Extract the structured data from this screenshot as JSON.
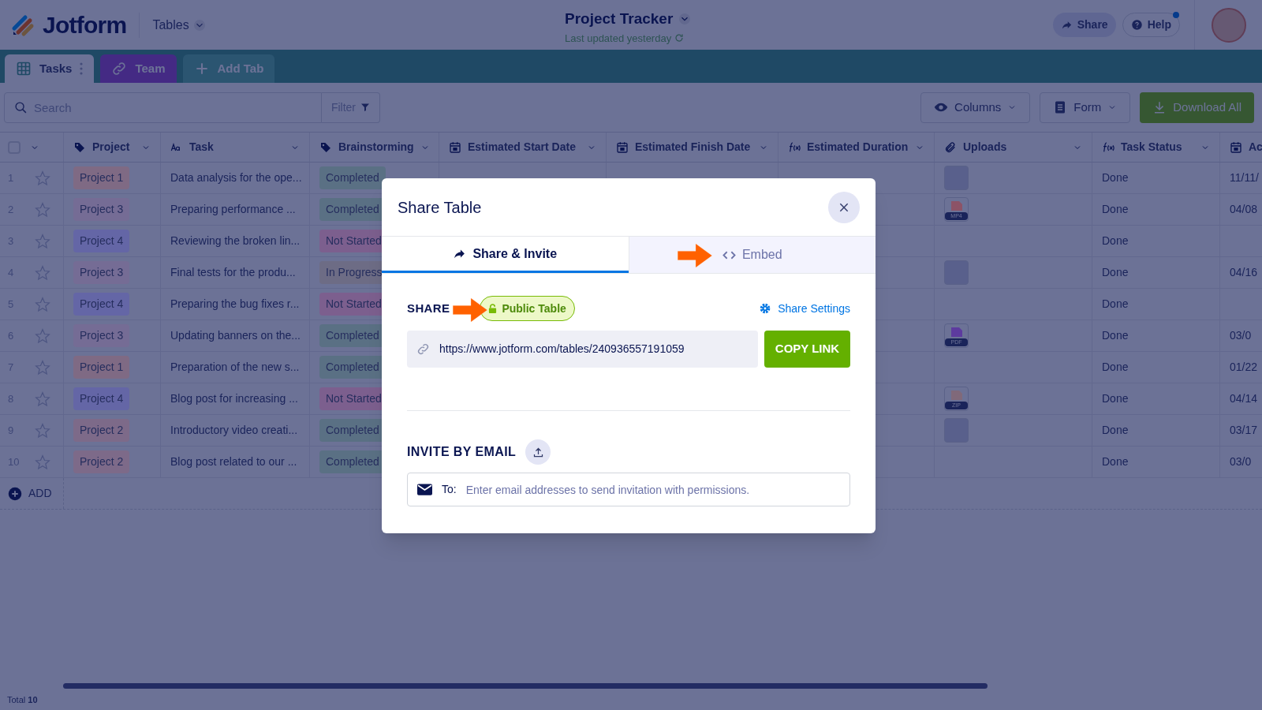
{
  "header": {
    "logo": "Jotform",
    "app_menu": "Tables",
    "title": "Project Tracker",
    "subtitle": "Last updated yesterday",
    "buttons": [
      {
        "kind": "share",
        "label": "Share"
      },
      {
        "kind": "help",
        "label": "Help",
        "notification": true
      }
    ]
  },
  "tabs": [
    {
      "label": "Tasks",
      "kind": "grid",
      "selected": true
    },
    {
      "label": "Team",
      "kind": "link",
      "selected": false
    },
    {
      "label": "Add Tab",
      "kind": "add",
      "selected": false
    }
  ],
  "toolbar": {
    "search": {
      "placeholder": "Search"
    },
    "filter": "Filter",
    "buttons": [
      {
        "kind": "eye",
        "label": "Columns"
      },
      {
        "kind": "form",
        "label": "Form"
      },
      {
        "kind": "download",
        "label": "Download All"
      }
    ]
  },
  "table": {
    "select_all_checked": false,
    "columns": [
      {
        "label": "Project",
        "kind": "tag"
      },
      {
        "label": "Task",
        "kind": "text"
      },
      {
        "label": "Brainstorming",
        "kind": "tag"
      },
      {
        "label": "Estimated Start Date",
        "kind": "calendar"
      },
      {
        "label": "Estimated Finish Date",
        "kind": "calendar"
      },
      {
        "label": "Estimated Duration",
        "kind": "formula"
      },
      {
        "label": "Uploads",
        "kind": "attachment"
      },
      {
        "label": "Task Status",
        "kind": "formula"
      },
      {
        "label": "Ac",
        "kind": "calendar"
      }
    ],
    "rows": [
      {
        "number": "1",
        "starred": false,
        "project": {
          "label": "Project 1",
          "color": "#7f6a84"
        },
        "task": "Data analysis for the ope...",
        "brainstorming": {
          "label": "Completed",
          "color": "#5a7084"
        },
        "upload": {
          "kind": "image"
        },
        "status": "Done",
        "column_9": "11/11/"
      },
      {
        "number": "2",
        "starred": false,
        "project": {
          "label": "Project 3",
          "color": "#756c95"
        },
        "task": "Preparing performance ...",
        "brainstorming": {
          "label": "Completed",
          "color": "#5a7084"
        },
        "upload": {
          "kind": "file",
          "label": "MP4",
          "color": "#8c5367"
        },
        "status": "Done",
        "column_9": "04/08"
      },
      {
        "number": "3",
        "starred": false,
        "project": {
          "label": "Project 4",
          "color": "#6466a6"
        },
        "task": "Reviewing the broken lin...",
        "brainstorming": {
          "label": "Not Started",
          "color": "#7c5f8e"
        },
        "status": "Done"
      },
      {
        "number": "4",
        "starred": false,
        "project": {
          "label": "Project 3",
          "color": "#756c95"
        },
        "task": "Final tests for the produ...",
        "brainstorming": {
          "label": "In Progress",
          "color": "#6d6c85"
        },
        "upload": {
          "kind": "image"
        },
        "status": "Done",
        "column_9": "04/16"
      },
      {
        "number": "5",
        "starred": false,
        "project": {
          "label": "Project 4",
          "color": "#6466a6"
        },
        "task": "Preparing the bug fixes r...",
        "brainstorming": {
          "label": "Not Started",
          "color": "#7c5f8e"
        },
        "status": "Done"
      },
      {
        "number": "6",
        "starred": false,
        "project": {
          "label": "Project 3",
          "color": "#756c95"
        },
        "task": "Updating banners on the...",
        "brainstorming": {
          "label": "Completed",
          "color": "#5a7084"
        },
        "upload": {
          "kind": "file",
          "label": "PDF",
          "color": "#5d3b9f"
        },
        "status": "Done",
        "column_9": "03/0"
      },
      {
        "number": "7",
        "starred": false,
        "project": {
          "label": "Project 1",
          "color": "#7f6a84"
        },
        "task": "Preparation of the new s...",
        "brainstorming": {
          "label": "Completed",
          "color": "#5a7084"
        },
        "status": "Done",
        "column_9": "01/22"
      },
      {
        "number": "8",
        "starred": false,
        "project": {
          "label": "Project 4",
          "color": "#6466a6"
        },
        "task": "Blog post for increasing ...",
        "brainstorming": {
          "label": "Not Started",
          "color": "#7c5f8e"
        },
        "upload": {
          "kind": "file",
          "label": "ZIP",
          "color": "#80697a"
        },
        "status": "Done",
        "column_9": "04/14"
      },
      {
        "number": "9",
        "starred": false,
        "project": {
          "label": "Project 2",
          "color": "#7d6a89"
        },
        "task": "Introductory video creati...",
        "brainstorming": {
          "label": "Completed",
          "color": "#5a7084"
        },
        "upload": {
          "kind": "image"
        },
        "status": "Done",
        "column_9": "03/17"
      },
      {
        "number": "10",
        "starred": false,
        "project": {
          "label": "Project 2",
          "color": "#7d6a89"
        },
        "task": "Blog post related to our ...",
        "brainstorming": {
          "label": "Completed",
          "color": "#5a7084"
        },
        "status": "Done",
        "column_9": "03/0"
      }
    ],
    "add_label": "ADD"
  },
  "status_bar": {
    "total_label": "Total",
    "total": "10"
  },
  "dialog": {
    "title": "Share Table",
    "tabs": [
      {
        "label": "Share & Invite",
        "kind": "share",
        "selected": true
      },
      {
        "label": "Embed",
        "kind": "embed",
        "selected": false
      }
    ],
    "share_link": {
      "heading": "SHARE",
      "badge": "Public Table",
      "settings": "Share Settings",
      "url": "https://www.jotform.com/tables/240936557191059",
      "copy_button": "COPY LINK"
    },
    "invite": {
      "heading": "INVITE BY EMAIL",
      "to_label": "To:",
      "placeholder": "Enter email addresses to send invitation with permissions."
    }
  },
  "annotations": [
    {
      "kind": "arrow"
    },
    {
      "kind": "arrow"
    }
  ]
}
